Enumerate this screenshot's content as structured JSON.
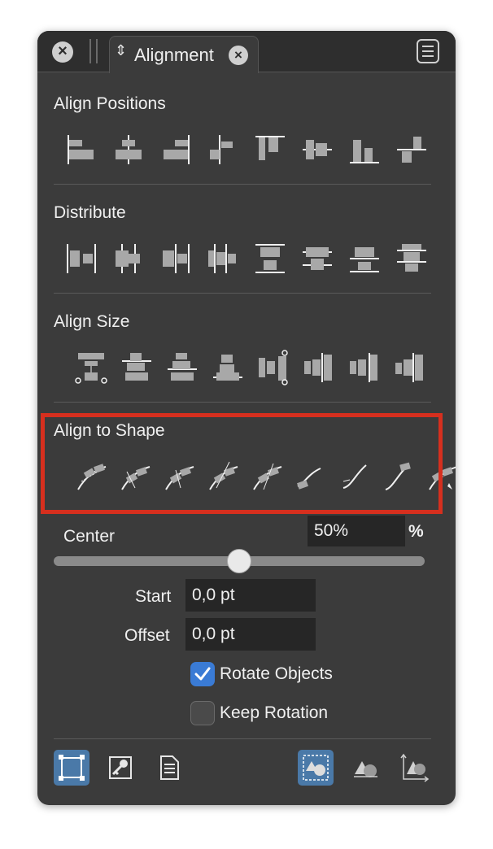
{
  "tab": {
    "title": "Alignment",
    "chevron": "⌃⌄"
  },
  "sections": {
    "align_positions": "Align Positions",
    "distribute": "Distribute",
    "align_size": "Align Size",
    "align_to_shape": "Align to Shape"
  },
  "align_positions_icons": [
    "align-left-icon",
    "align-center-horizontal-icon",
    "align-right-icon",
    "align-left-edge-right-icon",
    "align-top-icon",
    "align-middle-vertical-icon",
    "align-bottom-icon",
    "align-bottom-edge-top-icon"
  ],
  "distribute_icons": [
    "distribute-left-icon",
    "distribute-center-horizontal-icon",
    "distribute-right-icon",
    "distribute-spacing-horizontal-icon",
    "distribute-top-icon",
    "distribute-middle-vertical-icon",
    "distribute-bottom-icon",
    "distribute-spacing-vertical-icon"
  ],
  "align_size_icons": [
    "size-width-largest-icon",
    "size-width-1-icon",
    "size-width-2-icon",
    "size-width-3-icon",
    "size-height-largest-icon",
    "size-height-1-icon",
    "size-height-2-icon",
    "size-height-3-icon"
  ],
  "align_to_shape_icons": [
    "shape-align-above-icon",
    "shape-align-center-1-icon",
    "shape-align-center-2-icon",
    "shape-align-center-3-icon",
    "shape-align-center-4-icon",
    "shape-align-curve-1-icon",
    "shape-align-curve-2-icon",
    "shape-align-curve-3-icon",
    "shape-align-curve-pointer-icon"
  ],
  "center": {
    "label": "Center",
    "value": "50%",
    "unit": "%",
    "slider_fraction": 0.5
  },
  "start": {
    "label": "Start",
    "value": "0,0 pt"
  },
  "offset": {
    "label": "Offset",
    "value": "0,0 pt"
  },
  "rotate_objects": {
    "label": "Rotate Objects",
    "checked": true
  },
  "keep_rotation": {
    "label": "Keep Rotation",
    "checked": false
  },
  "bottom_toolbar": [
    "selection-frame-icon",
    "key-icon",
    "page-icon",
    "shape-selection-icon",
    "shape-align-icon",
    "shape-transform-icon"
  ],
  "colors": {
    "highlight": "#d62f1e",
    "accent": "#3a7bd5",
    "panel": "#3b3b3b"
  }
}
